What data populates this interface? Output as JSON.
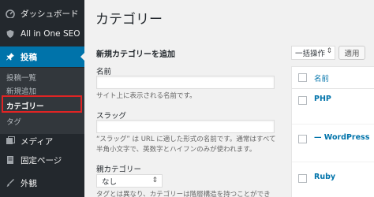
{
  "sidebar": {
    "items": [
      {
        "label": "ダッシュボード",
        "icon": "dashboard-icon"
      },
      {
        "label": "All in One SEO",
        "icon": "shield-icon"
      },
      {
        "label": "投稿",
        "icon": "pushpin-icon"
      },
      {
        "label": "メディア",
        "icon": "media-icon"
      },
      {
        "label": "固定ページ",
        "icon": "page-icon"
      },
      {
        "label": "外観",
        "icon": "brush-icon"
      }
    ],
    "submenu": [
      "投稿一覧",
      "新規追加",
      "カテゴリー",
      "タグ"
    ]
  },
  "main": {
    "title": "カテゴリー",
    "form": {
      "heading": "新規カテゴリーを追加",
      "name_label": "名前",
      "name_help": "サイト上に表示される名前です。",
      "slug_label": "スラッグ",
      "slug_help_1": "“スラッグ” は URL に適した形式の名前です。通常はすべて",
      "slug_help_2": "半角小文字で、英数字とハイフンのみが使われます。",
      "parent_label": "親カテゴリー",
      "parent_value": "なし",
      "parent_help": "タグとは異なり、カテゴリーは階層構造を持つことができ"
    },
    "table": {
      "bulk_action": "一括操作",
      "apply": "適用",
      "col_name": "名前",
      "rows": [
        "PHP",
        "— WordPress",
        "Ruby"
      ]
    }
  },
  "colors": {
    "sidebar_bg": "#23282d",
    "active_bg": "#0073aa",
    "link": "#0073aa",
    "highlight": "#e02424"
  }
}
